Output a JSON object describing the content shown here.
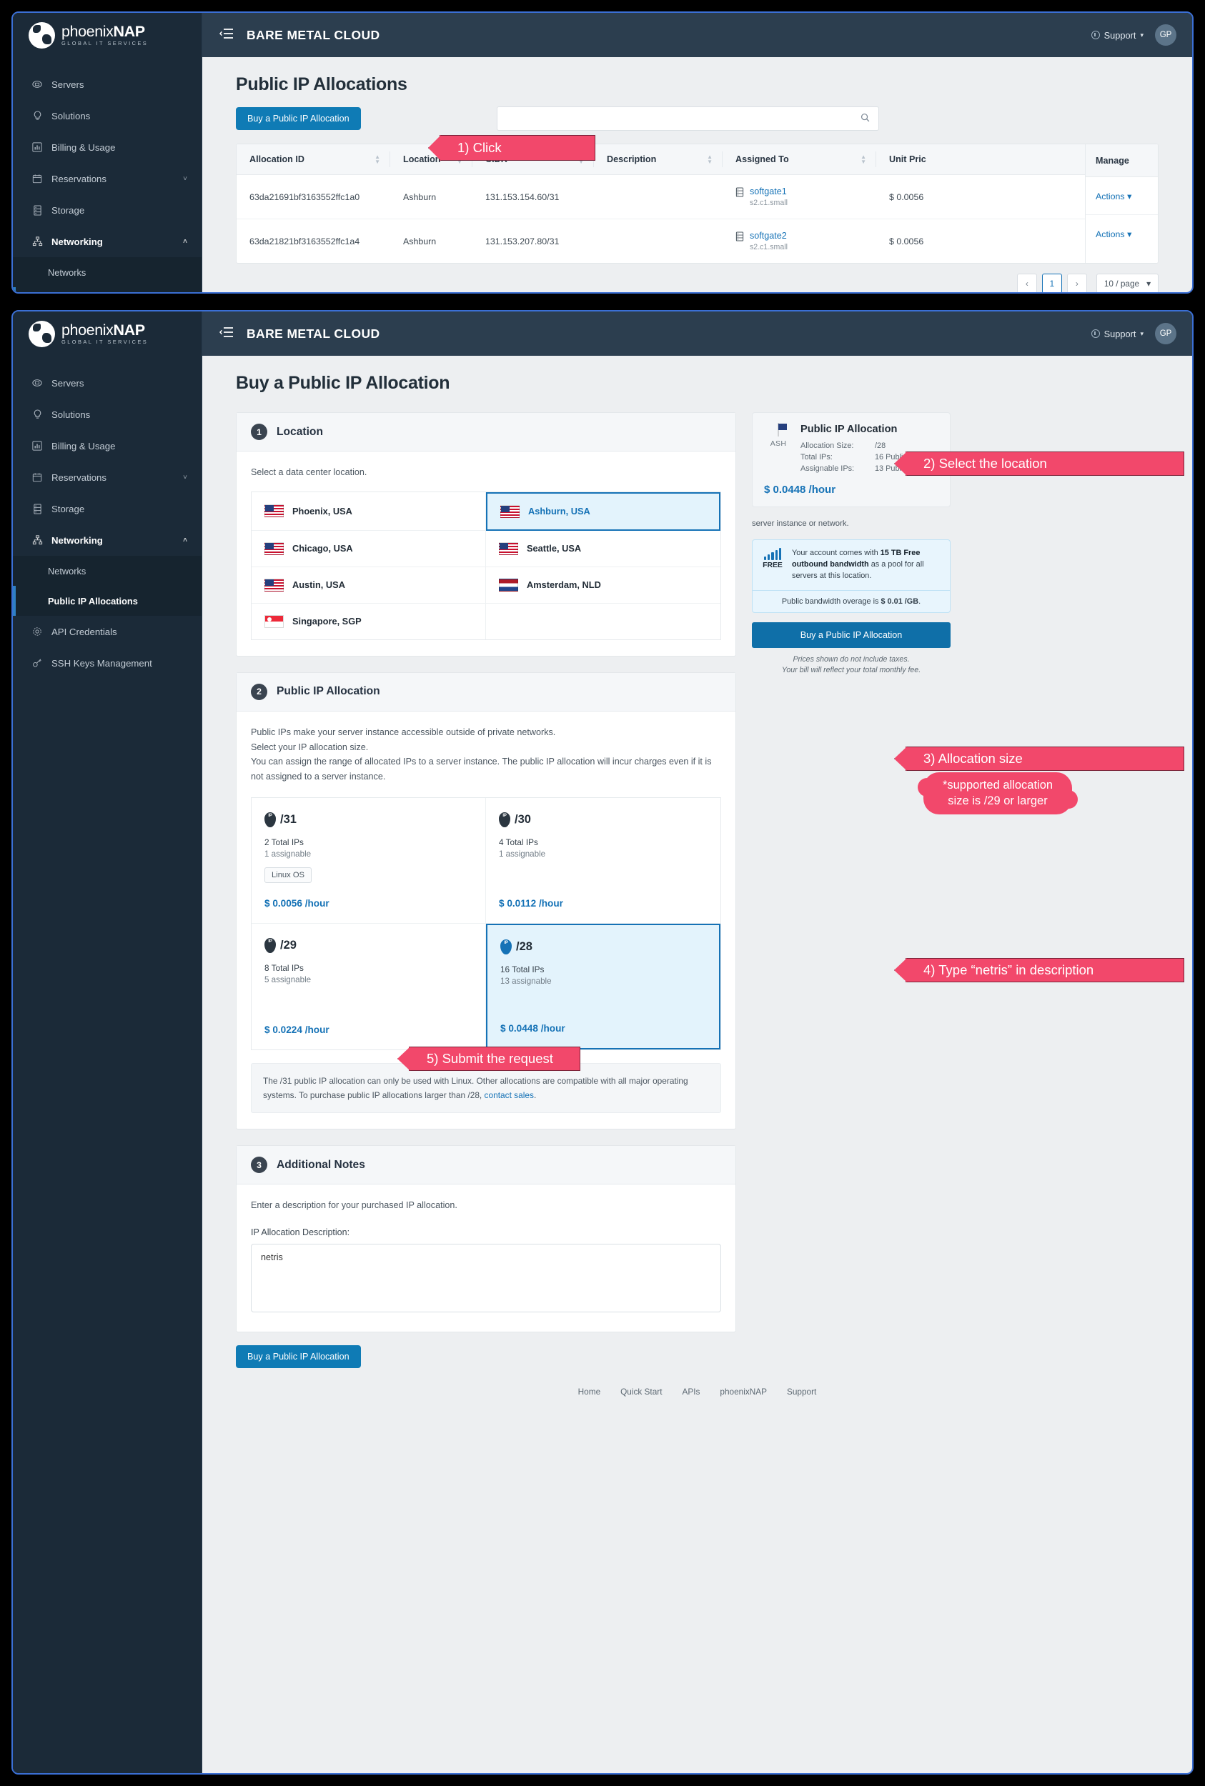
{
  "brand": {
    "logo_main": "phoenixNAP",
    "logo_main_bold": "NAP",
    "logo_sub": "GLOBAL IT SERVICES",
    "app_title": "BARE METAL CLOUD"
  },
  "topbar": {
    "support_label": "Support",
    "avatar_initials": "GP"
  },
  "sidebar": {
    "items": [
      {
        "label": "Servers",
        "icon": "servers-icon"
      },
      {
        "label": "Solutions",
        "icon": "lightbulb-icon"
      },
      {
        "label": "Billing & Usage",
        "icon": "chart-icon"
      },
      {
        "label": "Reservations",
        "icon": "calendar-icon",
        "chevron": "˅"
      },
      {
        "label": "Storage",
        "icon": "storage-icon"
      },
      {
        "label": "Networking",
        "icon": "network-icon",
        "chevron": "˄",
        "active": true
      }
    ],
    "sub_items": [
      {
        "label": "Networks"
      },
      {
        "label": "Public IP Allocations",
        "active": true
      }
    ],
    "items_after": [
      {
        "label": "API Credentials",
        "icon": "gear-icon"
      },
      {
        "label": "SSH Keys Management",
        "icon": "key-icon"
      }
    ]
  },
  "list_page": {
    "title": "Public IP Allocations",
    "buy_button": "Buy a Public IP Allocation",
    "search_placeholder": "",
    "search_value": "",
    "search_icon": "search-icon",
    "columns": [
      "Allocation ID",
      "Location",
      "CIDR",
      "Description",
      "Assigned To",
      "Unit Pric"
    ],
    "manage_column": "Manage",
    "rows": [
      {
        "allocation_id": "63da21691bf3163552ffc1a0",
        "location": "Ashburn",
        "cidr": "131.153.154.60/31",
        "description": "",
        "assigned_to": "softgate1",
        "assigned_type": "s2.c1.small",
        "unit_price": "$ 0.0056",
        "actions": "Actions"
      },
      {
        "allocation_id": "63da21821bf3163552ffc1a4",
        "location": "Ashburn",
        "cidr": "131.153.207.80/31",
        "description": "",
        "assigned_to": "softgate2",
        "assigned_type": "s2.c1.small",
        "unit_price": "$ 0.0056",
        "actions": "Actions"
      }
    ],
    "pagination": {
      "prev": "‹",
      "next": "›",
      "current_page": "1",
      "per_page": "10 / page"
    }
  },
  "buy_page": {
    "title": "Buy a Public IP Allocation",
    "step1": {
      "number": "1",
      "title": "Location",
      "helper": "Select a data center location.",
      "locations": [
        {
          "label": "Phoenix, USA",
          "flag": "us"
        },
        {
          "label": "Ashburn, USA",
          "flag": "us",
          "selected": true
        },
        {
          "label": "Chicago, USA",
          "flag": "us"
        },
        {
          "label": "Seattle, USA",
          "flag": "us"
        },
        {
          "label": "Austin, USA",
          "flag": "us"
        },
        {
          "label": "Amsterdam, NLD",
          "flag": "nl"
        },
        {
          "label": "Singapore, SGP",
          "flag": "sg"
        }
      ]
    },
    "step2": {
      "number": "2",
      "title": "Public IP Allocation",
      "helper_line1": "Public IPs make your server instance accessible outside of private networks.",
      "helper_line2": "Select your IP allocation size.",
      "helper_line3": "You can assign the range of allocated IPs to a server instance. The public IP allocation will incur charges even if it is not assigned to a server instance.",
      "sizes": [
        {
          "label": "/31",
          "total": "2 Total IPs",
          "assignable": "1 assignable",
          "os_tag": "Linux OS",
          "price": "$ 0.0056 /hour"
        },
        {
          "label": "/30",
          "total": "4 Total IPs",
          "assignable": "1 assignable",
          "os_tag": "",
          "price": "$ 0.0112 /hour"
        },
        {
          "label": "/29",
          "total": "8 Total IPs",
          "assignable": "5 assignable",
          "os_tag": "",
          "price": "$ 0.0224 /hour"
        },
        {
          "label": "/28",
          "total": "16 Total IPs",
          "assignable": "13 assignable",
          "os_tag": "",
          "price": "$ 0.0448 /hour",
          "selected": true
        }
      ],
      "note_text": "The /31 public IP allocation can only be used with Linux. Other allocations are compatible with all major operating systems. To purchase public IP allocations larger than /28, ",
      "note_link": "contact sales",
      "note_end": "."
    },
    "step3": {
      "number": "3",
      "title": "Additional Notes",
      "helper": "Enter a description for your purchased IP allocation.",
      "field_label": "IP Allocation Description:",
      "description_value": "netris",
      "description_placeholder": ""
    },
    "submit_button": "Buy a Public IP Allocation",
    "summary": {
      "flag_code": "ASH",
      "title": "Public IP Allocation",
      "rows": [
        {
          "key": "Allocation Size:",
          "value": "/28"
        },
        {
          "key": "Total IPs:",
          "value": "16 Public IPs"
        },
        {
          "key": "Assignable IPs:",
          "value": "13 Public IPs"
        }
      ],
      "price": "$ 0.0448 /hour",
      "hidden_text": "server instance or network.",
      "free_badge": "FREE",
      "free_text_pre": "Your account comes with ",
      "free_text_bold1": "15 TB Free outbound bandwidth",
      "free_text_mid": " as a pool for all servers at this location.",
      "overage_pre": "Public bandwidth overage is ",
      "overage_bold": "$ 0.01 /GB",
      "overage_end": ".",
      "buy_button": "Buy a Public IP Allocation",
      "disclaimer_line1": "Prices shown do not include taxes.",
      "disclaimer_line2": "Your bill will reflect your total monthly fee."
    },
    "footer_links": [
      "Home",
      "Quick Start",
      "APIs",
      "phoenixNAP",
      "Support"
    ]
  },
  "annotations": {
    "step1": "1) Click",
    "step2": "2) Select the location",
    "step3": "3) Allocation size",
    "step3_note": "*supported allocation\nsize is /29 or larger",
    "step4": "4) Type “netris” in description",
    "step5": "5) Submit the request"
  },
  "colors": {
    "accent_blue": "#1572b6",
    "sidebar": "#1b2a38",
    "topbar": "#2c3e4f",
    "annotation": "#f2486b"
  }
}
